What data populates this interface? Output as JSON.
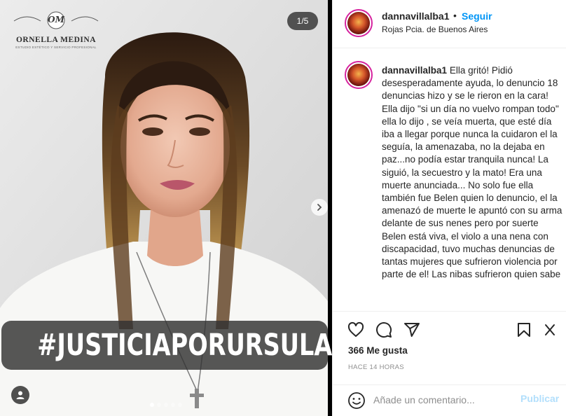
{
  "media": {
    "brand_monogram": "OM",
    "brand_name": "ORNELLA MEDINA",
    "brand_tagline": "ESTUDIO ESTÉTICO Y SERVICIO PROFESIONAL",
    "counter": "1/5",
    "banner_text": "#JUSTICIAPORURSULA",
    "carousel_total": 5,
    "carousel_current": 1
  },
  "header": {
    "username": "dannavillalba1",
    "separator": "•",
    "follow_label": "Seguir",
    "location": "Rojas Pcia. de Buenos Aires"
  },
  "caption": {
    "username": "dannavillalba1",
    "text": "Ella gritó! Pidió desesperadamente ayuda, lo denuncio 18 denuncias hizo y se le rieron en la cara! Ella dijo \"si un día no vuelvo rompan todo\" ella lo dijo , se veía muerta, que esté día iba a llegar porque nunca la cuidaron el la seguía, la amenazaba, no la dejaba en paz...no podía estar tranquila nunca! La siguió, la secuestro y la mato! Era una muerte anunciada... No solo fue ella también fue Belen quien lo denuncio, el la amenazó de muerte le apuntó con su arma delante de sus nenes pero por suerte Belen está viva, el violo a una nena con discapacidad, tuvo muchas denuncias de tantas mujeres que sufrieron violencia por parte de el! Las nibas sufrieron quien sabe"
  },
  "actions": {
    "likes": "366 Me gusta",
    "time": "HACE 14 HORAS"
  },
  "comment_box": {
    "placeholder": "Añade un comentario...",
    "publish_label": "Publicar"
  },
  "colors": {
    "link_blue": "#0095f6",
    "publish_disabled": "#b2dffc",
    "story_ring": "#d6249f",
    "muted": "#8e8e8e"
  },
  "icons": [
    "heart-icon",
    "comment-icon",
    "share-icon",
    "bookmark-icon",
    "emoji-icon",
    "chevron-right-icon",
    "user-tag-icon"
  ]
}
